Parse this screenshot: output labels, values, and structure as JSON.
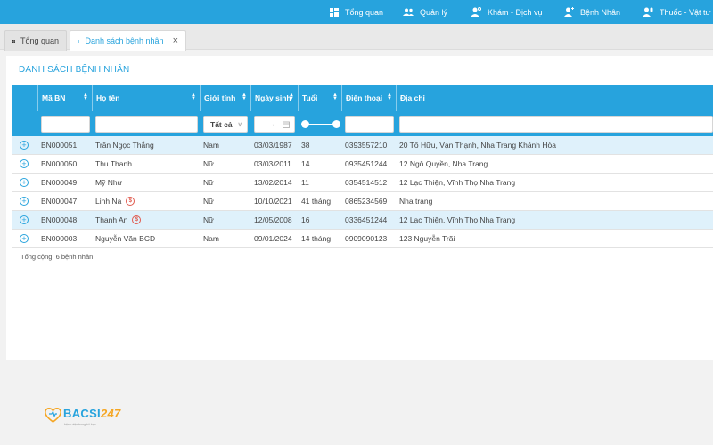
{
  "nav": {
    "items": [
      {
        "label": "Tổng quan",
        "icon": "dashboard-icon"
      },
      {
        "label": "Quản lý",
        "icon": "users-icon"
      },
      {
        "label": "Khám - Dịch vụ",
        "icon": "doctor-icon"
      },
      {
        "label": "Bệnh Nhân",
        "icon": "patient-icon"
      },
      {
        "label": "Thuốc - Vật tư",
        "icon": "medicine-icon"
      }
    ]
  },
  "tabs": {
    "overview": "Tổng quan",
    "patients": "Danh sách bệnh nhân",
    "close": "×"
  },
  "page": {
    "title": "DANH SÁCH BỆNH NHÂN",
    "total": "Tổng cộng: 6 bệnh nhân"
  },
  "table": {
    "columns": [
      "Mã BN",
      "Họ tên",
      "Giới tính",
      "Ngày sinh",
      "Tuổi",
      "Điện thoại",
      "Địa chỉ"
    ],
    "filters": {
      "gender": "Tất cả",
      "date_separator": "→"
    },
    "rows": [
      {
        "id": "BN000051",
        "name": "Trần Ngọc Thắng",
        "badge": "",
        "gender": "Nam",
        "dob": "03/03/1987",
        "age": "38",
        "phone": "0393557210",
        "address": "20 Tố Hữu, Vạn Thạnh, Nha Trang Khánh Hòa"
      },
      {
        "id": "BN000050",
        "name": "Thu Thanh",
        "badge": "",
        "gender": "Nữ",
        "dob": "03/03/2011",
        "age": "14",
        "phone": "0935451244",
        "address": "12 Ngô Quyền, Nha Trang"
      },
      {
        "id": "BN000049",
        "name": "Mỹ Như",
        "badge": "",
        "gender": "Nữ",
        "dob": "13/02/2014",
        "age": "11",
        "phone": "0354514512",
        "address": "12 Lạc Thiện, Vĩnh Thọ Nha Trang"
      },
      {
        "id": "BN000047",
        "name": "Linh Na",
        "badge": "$",
        "gender": "Nữ",
        "dob": "10/10/2021",
        "age": "41 tháng",
        "phone": "0865234569",
        "address": "Nha trang"
      },
      {
        "id": "BN000048",
        "name": "Thanh An",
        "badge": "$",
        "gender": "Nữ",
        "dob": "12/05/2008",
        "age": "16",
        "phone": "0336451244",
        "address": "12 Lạc Thiện, Vĩnh Thọ Nha Trang"
      },
      {
        "id": "BN000003",
        "name": "Nguyễn Văn BCD",
        "badge": "",
        "gender": "Nam",
        "dob": "09/01/2024",
        "age": "14 tháng",
        "phone": "0909090123",
        "address": "123 Nguyễn Trãi"
      }
    ]
  },
  "logo": {
    "brand": "BACSI",
    "suffix": "247",
    "tagline": "bệnh viện trong túi bạn"
  },
  "colors": {
    "primary": "#27a3dd",
    "row_alt": "#dff1fb",
    "badge": "#e05a4e",
    "logo_accent": "#f5a623"
  }
}
